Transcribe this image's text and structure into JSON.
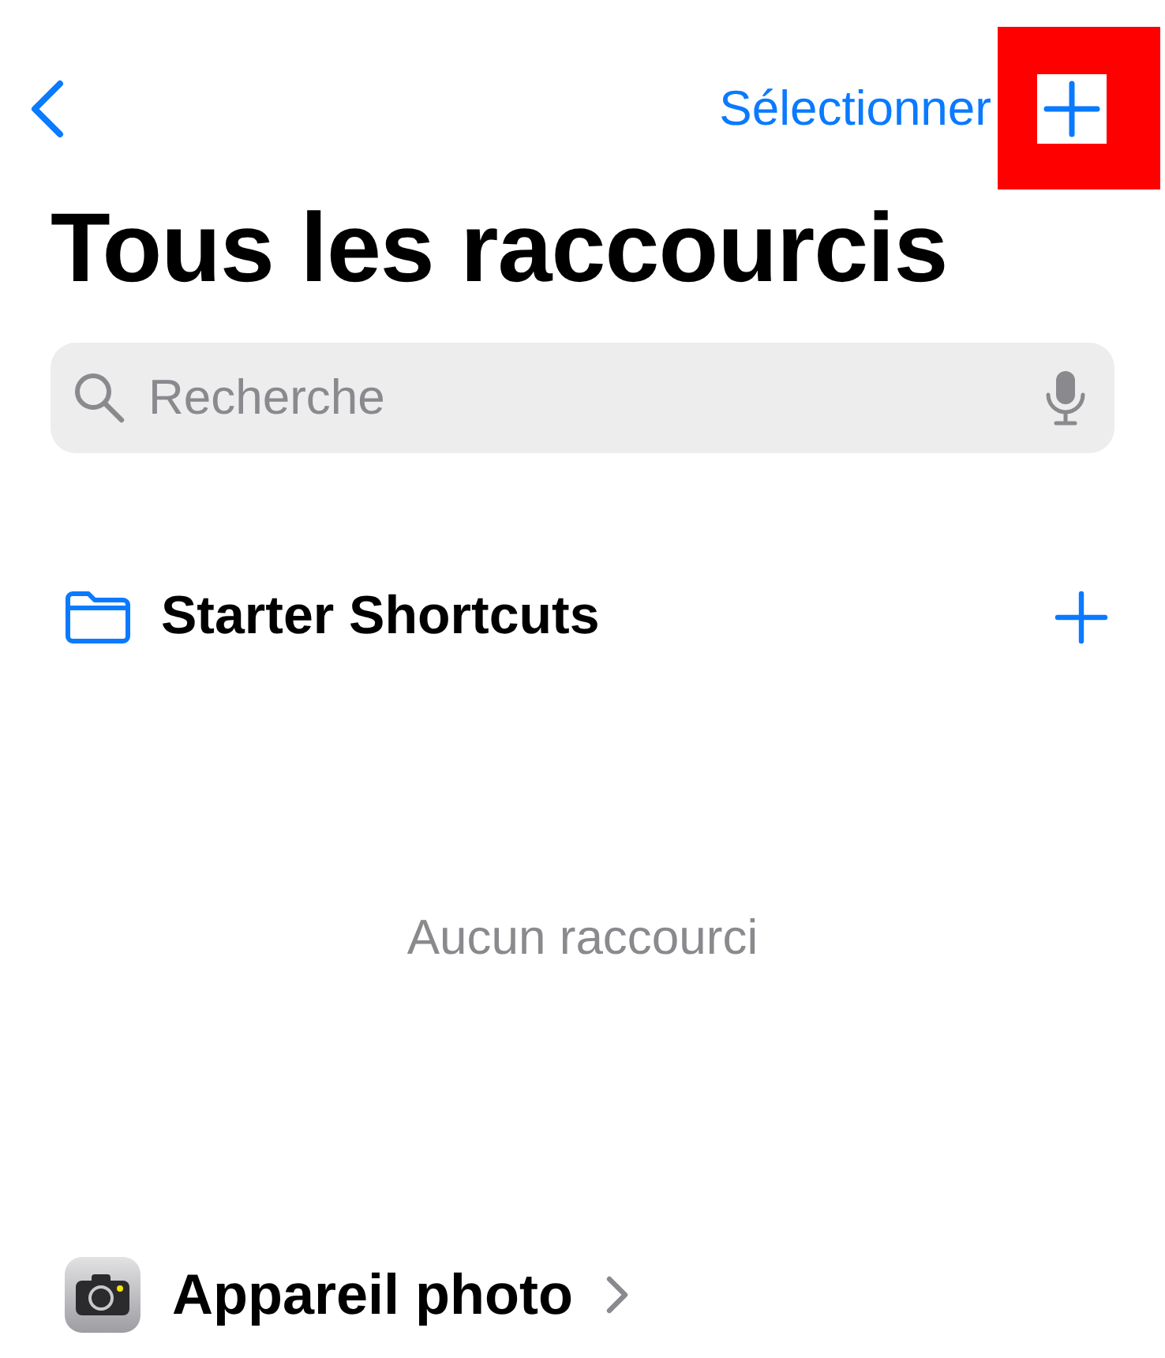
{
  "nav": {
    "select_label": "Sélectionner",
    "add_highlighted": true
  },
  "title": "Tous les raccourcis",
  "search": {
    "placeholder": "Recherche"
  },
  "folder": {
    "name": "Starter Shortcuts",
    "empty_text": "Aucun raccourci"
  },
  "app_section": {
    "name": "Appareil photo"
  }
}
